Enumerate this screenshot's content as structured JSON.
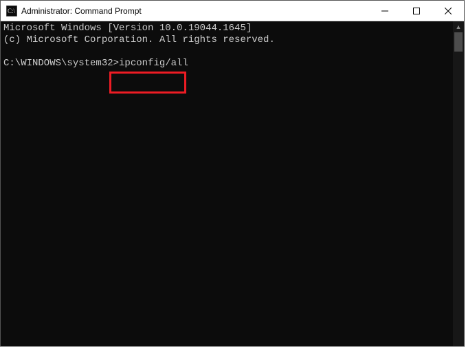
{
  "window": {
    "title": "Administrator: Command Prompt",
    "icon_name": "cmd-icon"
  },
  "console": {
    "line1": "Microsoft Windows [Version 10.0.19044.1645]",
    "line2": "(c) Microsoft Corporation. All rights reserved.",
    "blank": "",
    "prompt": "C:\\WINDOWS\\system32>",
    "command": "ipconfig/all"
  },
  "highlight": {
    "target": "ipconfig/all"
  }
}
